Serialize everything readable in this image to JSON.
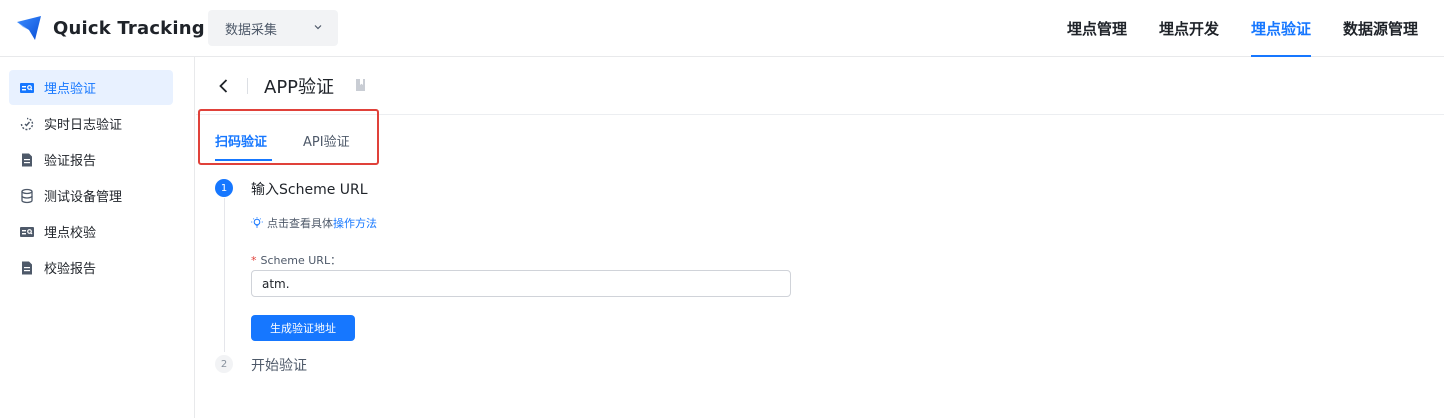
{
  "app": {
    "name": "Quick Tracking",
    "accent": "#1677ff"
  },
  "header": {
    "module_select": {
      "value": "数据采集"
    },
    "nav": [
      {
        "label": "埋点管理",
        "active": false
      },
      {
        "label": "埋点开发",
        "active": false
      },
      {
        "label": "埋点验证",
        "active": true
      },
      {
        "label": "数据源管理",
        "active": false
      }
    ]
  },
  "sidebar": {
    "items": [
      {
        "label": "埋点验证",
        "icon": "tracking-check-icon",
        "active": true
      },
      {
        "label": "实时日志验证",
        "icon": "realtime-log-icon",
        "active": false
      },
      {
        "label": "验证报告",
        "icon": "report-icon",
        "active": false
      },
      {
        "label": "测试设备管理",
        "icon": "device-database-icon",
        "active": false
      },
      {
        "label": "埋点校验",
        "icon": "tracking-validate-icon",
        "active": false
      },
      {
        "label": "校验报告",
        "icon": "validate-report-icon",
        "active": false
      }
    ]
  },
  "page": {
    "title": "APP验证",
    "tabs": [
      {
        "label": "扫码验证",
        "active": true
      },
      {
        "label": "API验证",
        "active": false
      }
    ],
    "steps": [
      {
        "number": "1",
        "title": "输入Scheme URL"
      },
      {
        "number": "2",
        "title": "开始验证"
      }
    ],
    "hint": {
      "text": "点击查看具体",
      "link": "操作方法"
    },
    "scheme_field": {
      "required_mark": "*",
      "label": "Scheme URL：",
      "value": "atm."
    },
    "generate_button": "生成验证地址"
  }
}
